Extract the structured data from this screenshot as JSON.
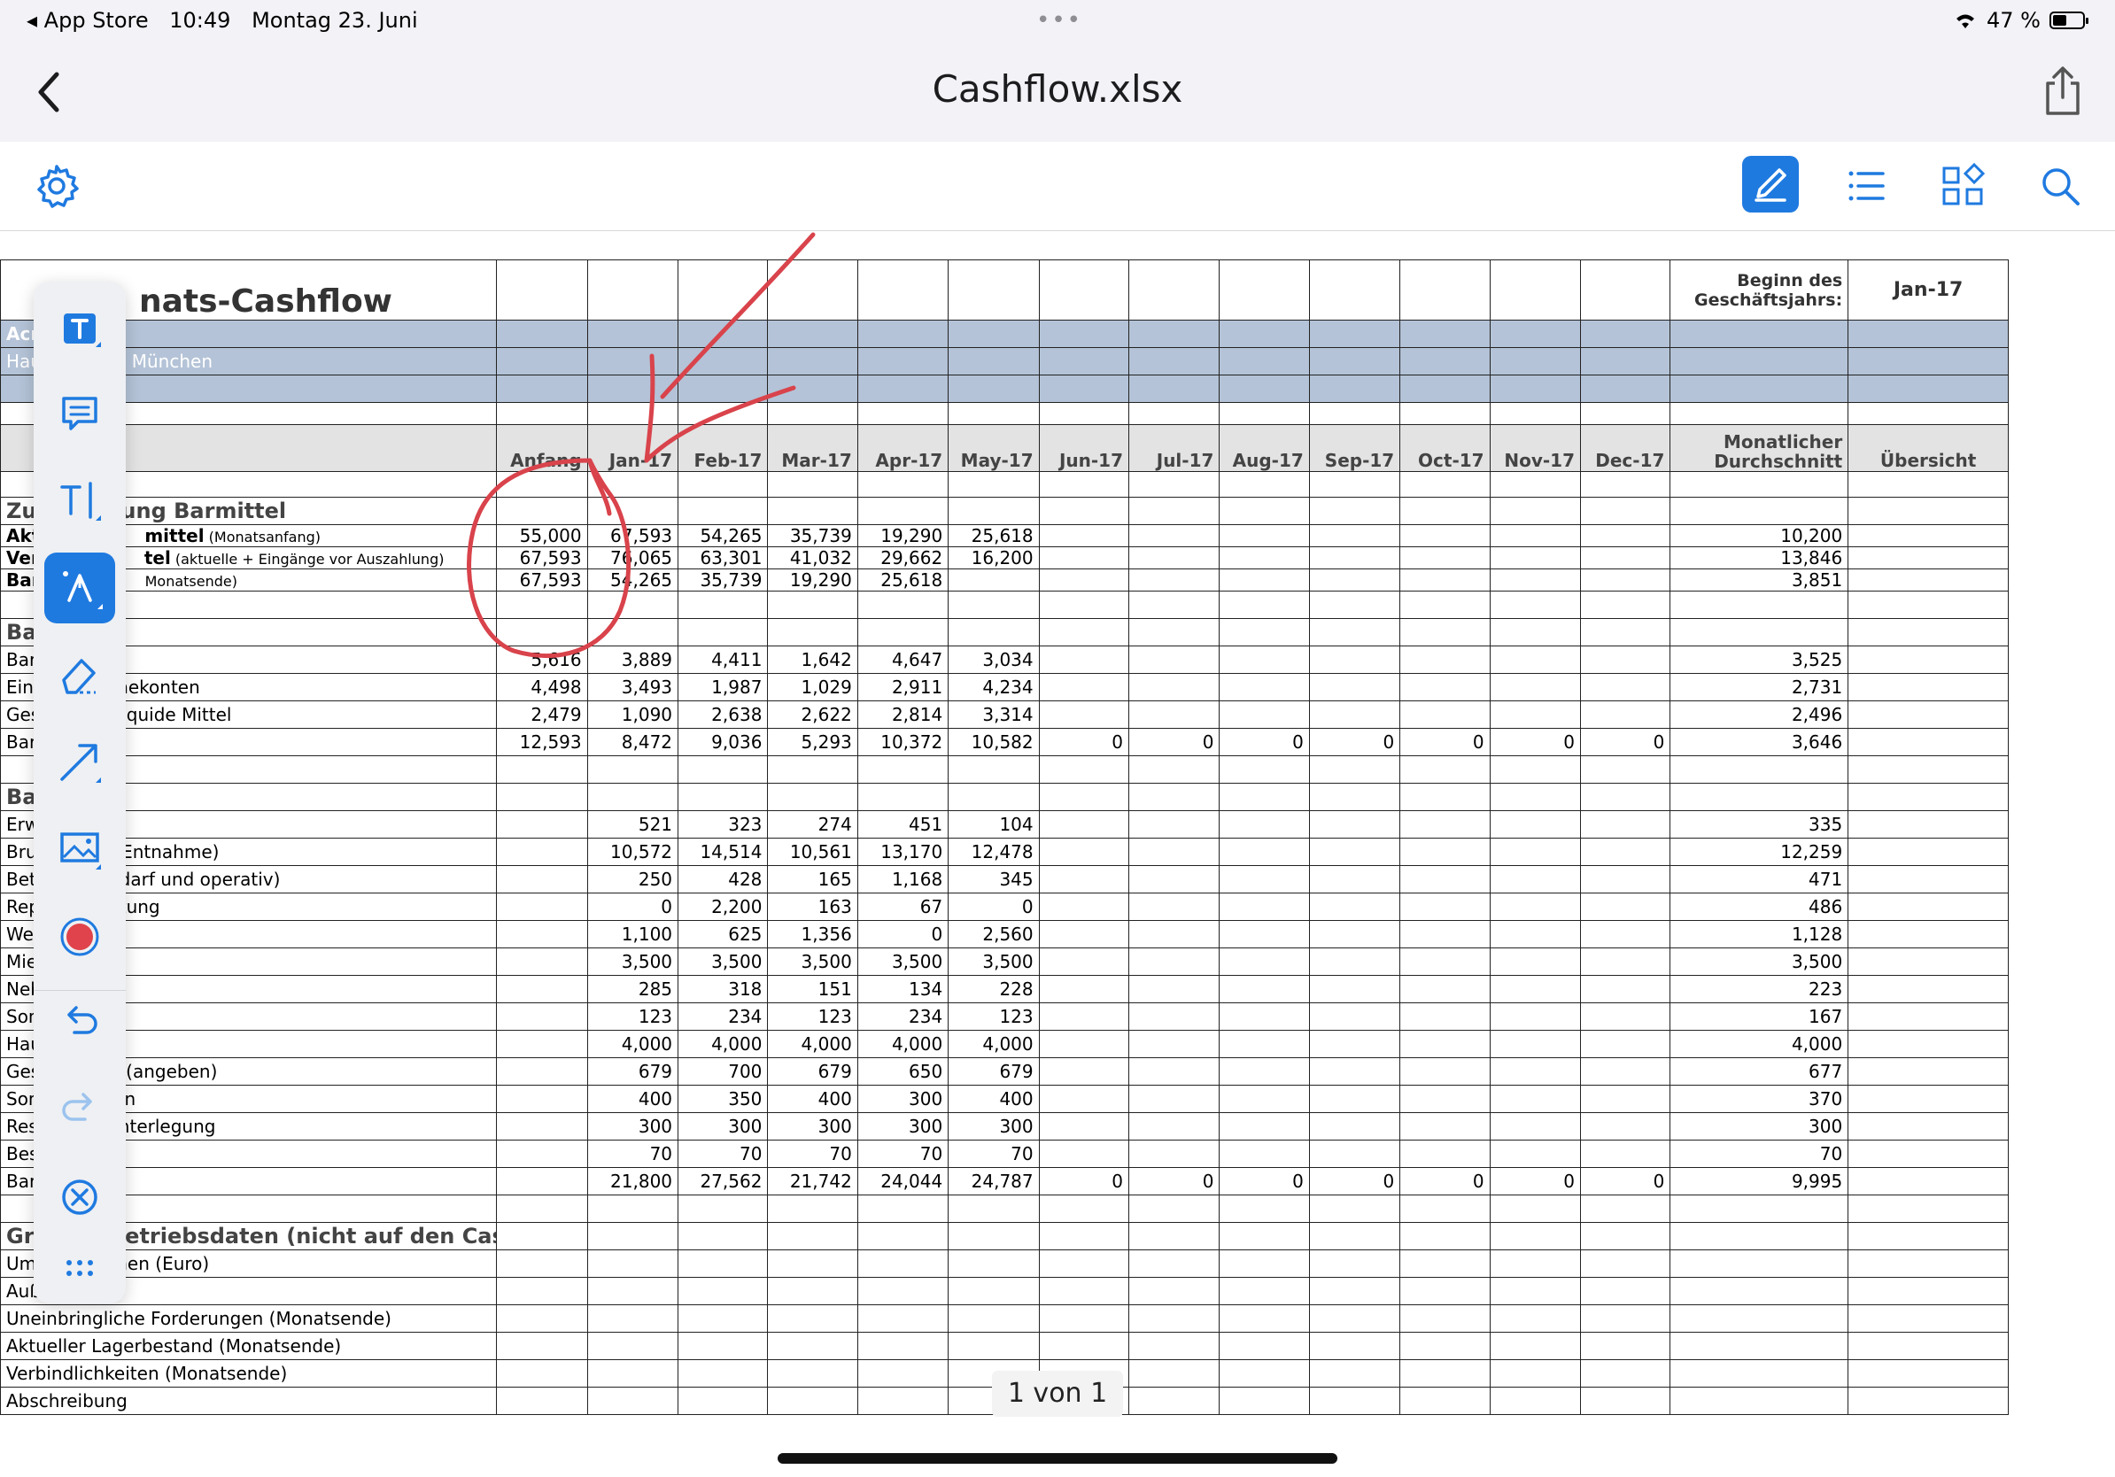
{
  "status_bar": {
    "back_app": "◂ App Store",
    "time": "10:49",
    "date": "Montag 23. Juni",
    "battery": "47 %"
  },
  "nav": {
    "title": "Cashflow.xlsx"
  },
  "sheet": {
    "title": "12-Monats-Cashflow",
    "title_visible": "nats-Cashflow",
    "company_line": "Acn",
    "address_line": "Hau                1, 80000 München",
    "fiscal_start_label": "Beginn des Geschäftsjahrs:",
    "fiscal_start_value": "Jan-17",
    "headers": [
      "Anfang",
      "Jan-17",
      "Feb-17",
      "Mar-17",
      "Apr-17",
      "May-17",
      "Jun-17",
      "Jul-17",
      "Aug-17",
      "Sep-17",
      "Oct-17",
      "Nov-17",
      "Dec-17",
      "Monatlicher Durchschnitt",
      "Übersicht"
    ],
    "summary_title": "Zus        nfassung Barmittel",
    "summary_rows": [
      {
        "label": "Akt",
        "label_bold_tail": "mittel",
        "note": " (Monatsanfang)",
        "values": [
          "55,000",
          "67,593",
          "54,265",
          "35,739",
          "19,290",
          "25,618",
          "",
          "",
          "",
          "",
          "",
          "",
          "",
          "10,200",
          ""
        ]
      },
      {
        "label": "Ver",
        "label_bold_tail": "tel",
        "note": " (aktuelle + Eingänge vor Auszahlung)",
        "values": [
          "67,593",
          "76,065",
          "63,301",
          "41,032",
          "29,662",
          "16,200",
          "",
          "",
          "",
          "",
          "",
          "",
          "",
          "13,846",
          ""
        ]
      },
      {
        "label": "Bar",
        "label_bold_tail": "",
        "note": "Monatsende)",
        "values": [
          "67,593",
          "54,265",
          "35,739",
          "19,290",
          "25,618",
          "",
          "",
          "",
          "",
          "",
          "",
          "",
          "",
          "3,851",
          ""
        ]
      }
    ],
    "income_title": "Bar         e",
    "income_rows": [
      {
        "label": "Barv",
        "values": [
          "5,616",
          "3,889",
          "4,411",
          "1,642",
          "4,647",
          "3,034",
          "",
          "",
          "",
          "",
          "",
          "",
          "",
          "3,525",
          ""
        ]
      },
      {
        "label": "Eing          Einnahmekonten",
        "values": [
          "4,498",
          "3,493",
          "1,987",
          "1,029",
          "2,911",
          "4,234",
          "",
          "",
          "",
          "",
          "",
          "",
          "",
          "2,731",
          ""
        ]
      },
      {
        "label": "Ges          onstige liquide Mittel",
        "values": [
          "2,479",
          "1,090",
          "2,638",
          "2,622",
          "2,814",
          "3,314",
          "",
          "",
          "",
          "",
          "",
          "",
          "",
          "2,496",
          ""
        ]
      },
      {
        "label": "Barz          esamt",
        "values": [
          "12,593",
          "8,472",
          "9,036",
          "5,293",
          "10,372",
          "10,582",
          "0",
          "0",
          "0",
          "0",
          "0",
          "0",
          "0",
          "3,646",
          ""
        ]
      }
    ],
    "expense_title": "Bar         e",
    "expense_rows": [
      {
        "label": "Erwe         eben)",
        "values": [
          "",
          "521",
          "323",
          "274",
          "451",
          "104",
          "",
          "",
          "",
          "",
          "",
          "",
          "",
          "335",
          ""
        ]
      },
      {
        "label": "Brut          genaue Entnahme)",
        "values": [
          "",
          "10,572",
          "14,514",
          "10,561",
          "13,170",
          "12,478",
          "",
          "",
          "",
          "",
          "",
          "",
          "",
          "12,259",
          ""
        ]
      },
      {
        "label": "Betr          (Bürobedarf und operativ)",
        "values": [
          "",
          "250",
          "428",
          "165",
          "1,168",
          "345",
          "",
          "",
          "",
          "",
          "",
          "",
          "",
          "471",
          ""
        ]
      },
      {
        "label": "Rep          und Wartung",
        "values": [
          "",
          "0",
          "2,200",
          "163",
          "67",
          "0",
          "",
          "",
          "",
          "",
          "",
          "",
          "",
          "486",
          ""
        ]
      },
      {
        "label": "Wer",
        "values": [
          "",
          "1,100",
          "625",
          "1,356",
          "0",
          "2,560",
          "",
          "",
          "",
          "",
          "",
          "",
          "",
          "1,128",
          ""
        ]
      },
      {
        "label": "Miet",
        "values": [
          "",
          "3,500",
          "3,500",
          "3,500",
          "3,500",
          "3,500",
          "",
          "",
          "",
          "",
          "",
          "",
          "",
          "3,500",
          ""
        ]
      },
      {
        "label": "Neb",
        "values": [
          "",
          "285",
          "318",
          "151",
          "134",
          "228",
          "",
          "",
          "",
          "",
          "",
          "",
          "",
          "223",
          ""
        ]
      },
      {
        "label": "Son          eben)",
        "values": [
          "",
          "123",
          "234",
          "123",
          "234",
          "123",
          "",
          "",
          "",
          "",
          "",
          "",
          "",
          "167",
          ""
        ]
      },
      {
        "label": "Hau          Kredit",
        "values": [
          "",
          "4,000",
          "4,000",
          "4,000",
          "4,000",
          "4,000",
          "",
          "",
          "",
          "",
          "",
          "",
          "",
          "4,000",
          ""
        ]
      },
      {
        "label": "Ges          stattung (angeben)",
        "values": [
          "",
          "679",
          "700",
          "679",
          "650",
          "679",
          "",
          "",
          "",
          "",
          "",
          "",
          "",
          "677",
          ""
        ]
      },
      {
        "label": "Son          zupkosten",
        "values": [
          "",
          "400",
          "350",
          "400",
          "300",
          "400",
          "",
          "",
          "",
          "",
          "",
          "",
          "",
          "370",
          ""
        ]
      },
      {
        "label": "Rese          oder Hinterlegung",
        "values": [
          "",
          "300",
          "300",
          "300",
          "300",
          "300",
          "",
          "",
          "",
          "",
          "",
          "",
          "",
          "300",
          ""
        ]
      },
      {
        "label": "Besi          hme",
        "values": [
          "",
          "70",
          "70",
          "70",
          "70",
          "70",
          "",
          "",
          "",
          "",
          "",
          "",
          "",
          "70",
          ""
        ]
      },
      {
        "label": "Bara          esamt",
        "values": [
          "",
          "21,800",
          "27,562",
          "21,742",
          "24,044",
          "24,787",
          "0",
          "0",
          "0",
          "0",
          "0",
          "0",
          "0",
          "9,995",
          ""
        ]
      }
    ],
    "ops_title": "Gru          nde Betriebsdaten (nicht auf den Cashflow bezogene Informationen)",
    "ops_rows": [
      {
        "label": "Umsatzvolumen (Euro)"
      },
      {
        "label": "Außenstände"
      },
      {
        "label": "Uneinbringliche Forderungen (Monatsende)"
      },
      {
        "label": "Aktueller Lagerbestand (Monatsende)"
      },
      {
        "label": "Verbindlichkeiten (Monatsende)"
      },
      {
        "label": "Abschreibung"
      }
    ]
  },
  "page_indicator": "1 von 1",
  "colors": {
    "accent": "#1f7ae0",
    "header_blue": "#b4c3d7",
    "annotation_red": "#d9434b",
    "record_red": "#e0434b"
  },
  "palette_tools": [
    "text-box-icon",
    "comment-icon",
    "text-cursor-icon",
    "pen-icon",
    "eraser-icon",
    "arrow-icon",
    "image-icon",
    "record-color-icon",
    "undo-icon",
    "redo-icon",
    "close-icon",
    "more-icon"
  ]
}
